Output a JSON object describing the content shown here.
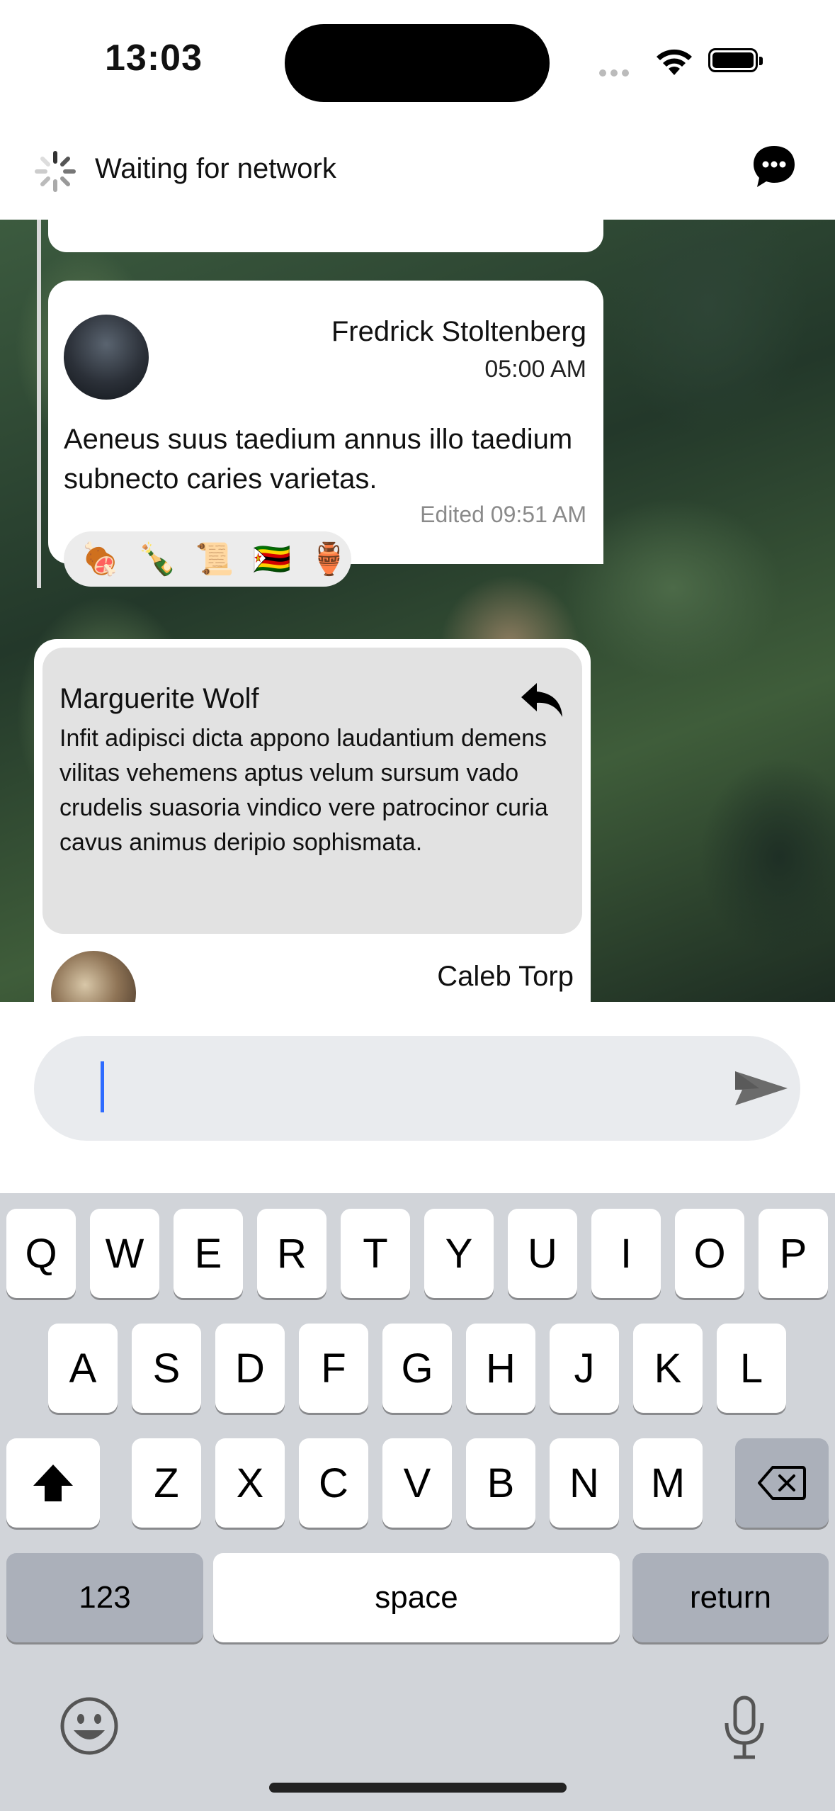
{
  "status_bar": {
    "time": "13:03"
  },
  "header": {
    "title": "Waiting for network",
    "chat_icon": "chat-bubble-icon",
    "spinner_icon": "spinner-icon"
  },
  "messages": [
    {
      "author": "Fredrick Stoltenberg",
      "time": "05:00 AM",
      "text": "Aeneus suus taedium annus illo taedium subnecto caries varietas.",
      "edited": "Edited 09:51 AM",
      "reactions": [
        "🍖",
        "🍾",
        "📜",
        "🇿🇼",
        "🏺"
      ]
    },
    {
      "quote": {
        "author": "Marguerite Wolf",
        "text": "Infit adipisci dicta appono laudantium demens vilitas vehemens aptus velum sursum vado crudelis suasoria vindico vere patrocinor curia cavus animus deripio sophismata."
      },
      "author": "Caleb Torp"
    }
  ],
  "input": {
    "value": "",
    "placeholder": ""
  },
  "keyboard": {
    "row1": [
      "Q",
      "W",
      "E",
      "R",
      "T",
      "Y",
      "U",
      "I",
      "O",
      "P"
    ],
    "row2": [
      "A",
      "S",
      "D",
      "F",
      "G",
      "H",
      "J",
      "K",
      "L"
    ],
    "row3": [
      "Z",
      "X",
      "C",
      "V",
      "B",
      "N",
      "M"
    ],
    "numbers_label": "123",
    "space_label": "space",
    "return_label": "return"
  },
  "colors": {
    "caret": "#2e6bff",
    "keyboard_bg": "#d1d4d9",
    "dark_key": "#abb0ba"
  }
}
